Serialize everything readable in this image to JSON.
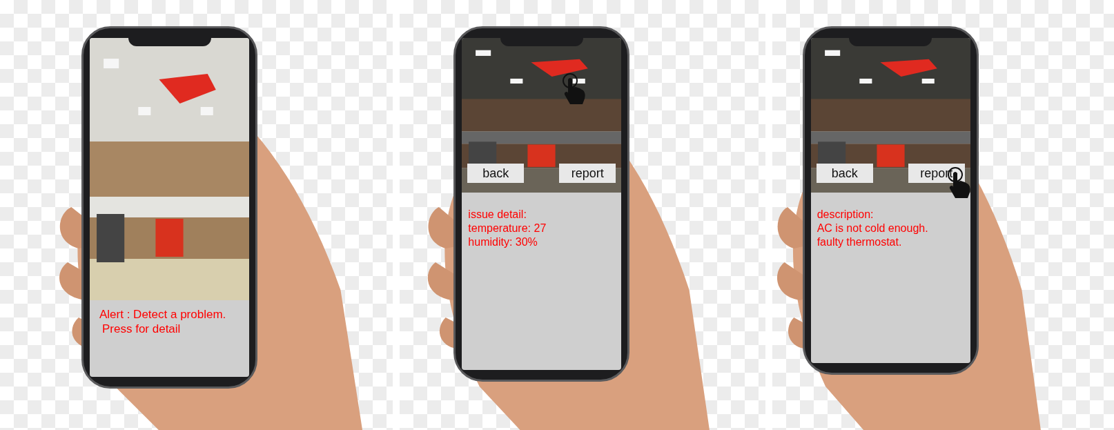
{
  "screens": [
    {
      "kind": "alert",
      "photo_tapped": false,
      "lines": [
        "Alert : Detect a problem.",
        "Press for detail"
      ]
    },
    {
      "kind": "detail",
      "photo_tapped": true,
      "buttons": [
        {
          "label": "back",
          "tapped": false
        },
        {
          "label": "report",
          "tapped": false
        }
      ],
      "lines": [
        "issue detail:",
        "temperature: 27",
        "humidity: 30%"
      ]
    },
    {
      "kind": "detail",
      "photo_tapped": false,
      "buttons": [
        {
          "label": "back",
          "tapped": false
        },
        {
          "label": "report",
          "tapped": true
        }
      ],
      "lines": [
        "description:",
        "AC is not cold enough.",
        "faulty thermostat."
      ]
    }
  ]
}
